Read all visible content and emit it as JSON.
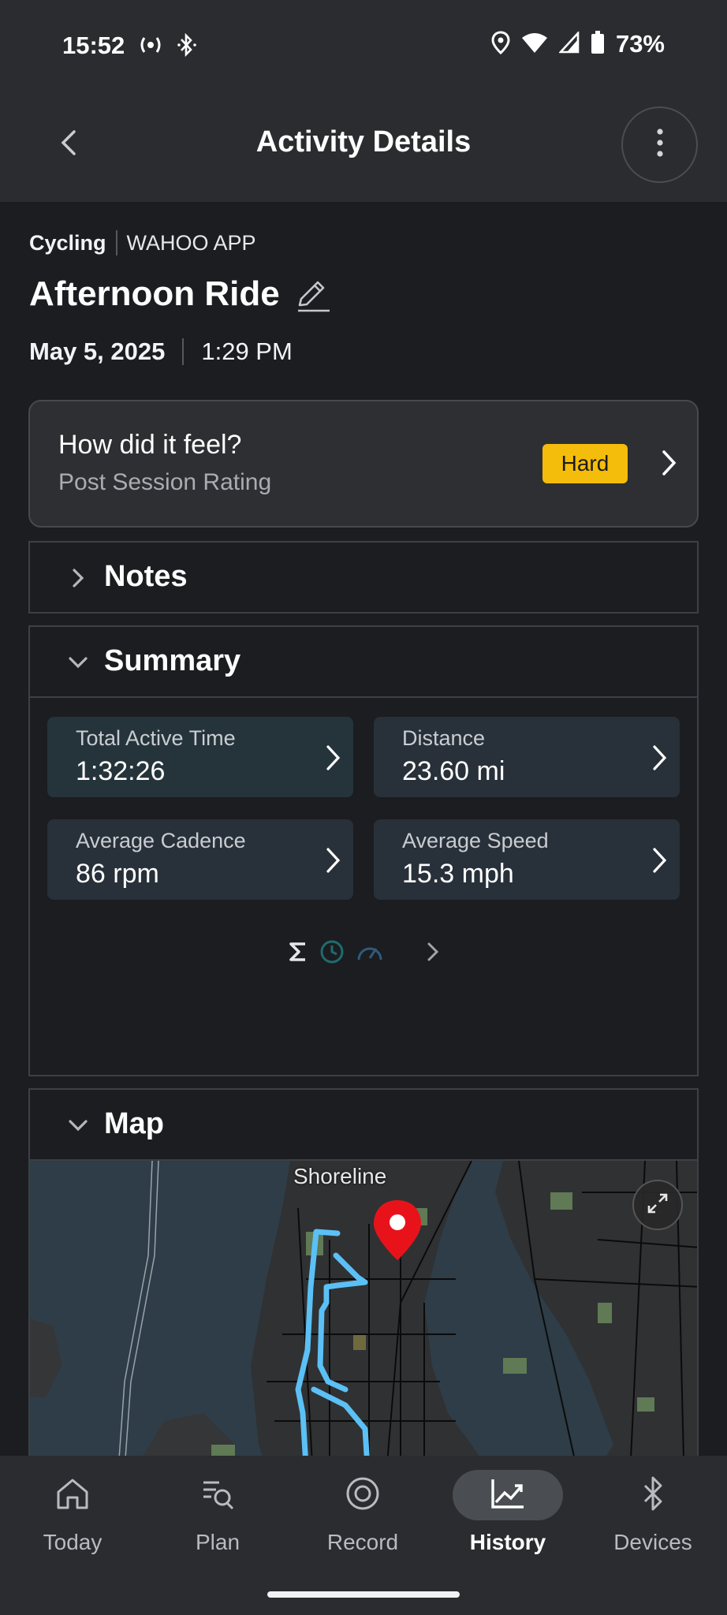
{
  "status_bar": {
    "time": "15:52",
    "battery_percent": "73%",
    "icons": [
      "radio-icon",
      "bluetooth-icon",
      "location-icon",
      "wifi-icon",
      "signal-icon",
      "battery-icon"
    ]
  },
  "app_bar": {
    "title": "Activity Details",
    "back_icon": "chevron-left-icon",
    "more_icon": "more-vertical-icon"
  },
  "activity": {
    "type": "Cycling",
    "source": "WAHOO APP",
    "title": "Afternoon Ride",
    "date": "May 5, 2025",
    "time": "1:29 PM"
  },
  "feel_card": {
    "title": "How did it feel?",
    "subtitle": "Post Session Rating",
    "rating": "Hard",
    "rating_color": "#f4bc0b"
  },
  "notes": {
    "title": "Notes",
    "expanded": false
  },
  "summary": {
    "title": "Summary",
    "expanded": true,
    "stats": [
      {
        "label": "Total Active Time",
        "value": "1:32:26"
      },
      {
        "label": "Distance",
        "value": "23.60 mi"
      },
      {
        "label": "Average Cadence",
        "value": "86 rpm"
      },
      {
        "label": "Average Speed",
        "value": "15.3 mph"
      }
    ],
    "pager_icons": [
      "sigma-icon",
      "clock-icon",
      "speedometer-icon",
      "chevron-right-icon"
    ]
  },
  "map": {
    "title": "Map",
    "expanded": true,
    "place_label": "Shoreline",
    "route_color": "#5bc0f5",
    "pin_color": "#e8131a"
  },
  "bottom_nav": {
    "items": [
      {
        "label": "Today",
        "icon": "home-icon",
        "active": false
      },
      {
        "label": "Plan",
        "icon": "plan-search-icon",
        "active": false
      },
      {
        "label": "Record",
        "icon": "record-icon",
        "active": false
      },
      {
        "label": "History",
        "icon": "history-chart-icon",
        "active": true
      },
      {
        "label": "Devices",
        "icon": "bluetooth-icon",
        "active": false
      }
    ]
  }
}
